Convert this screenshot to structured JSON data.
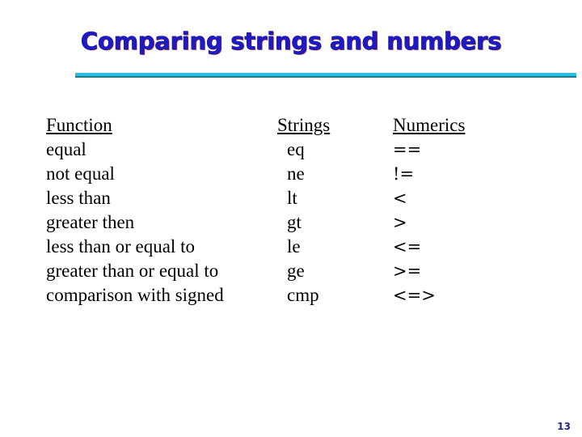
{
  "slide": {
    "title": "Comparing strings and numbers",
    "page_number": "13",
    "colors": {
      "background": "#ffffff",
      "title_text": "#1a1ac8",
      "title_shadow": "#8a1414",
      "rule": "#2cbdda",
      "rule_shadow": "#1d7d92",
      "body_text": "#000000",
      "page_number_text": "#222a7a"
    }
  },
  "table": {
    "headers": {
      "function": "Function",
      "strings": "Strings",
      "numerics": "Numerics"
    },
    "rows": [
      {
        "function": "equal",
        "strings": "eq",
        "numerics": "=="
      },
      {
        "function": "not equal",
        "strings": "ne",
        "numerics": "!="
      },
      {
        "function": "less than",
        "strings": "lt",
        "numerics": "<"
      },
      {
        "function": "greater then",
        "strings": "gt",
        "numerics": ">"
      },
      {
        "function": "less than or equal to",
        "strings": "le",
        "numerics": "<="
      },
      {
        "function": "greater than or equal to",
        "strings": "ge",
        "numerics": ">="
      },
      {
        "function": "comparison with signed",
        "strings": "cmp",
        "numerics": "<=>"
      }
    ]
  }
}
